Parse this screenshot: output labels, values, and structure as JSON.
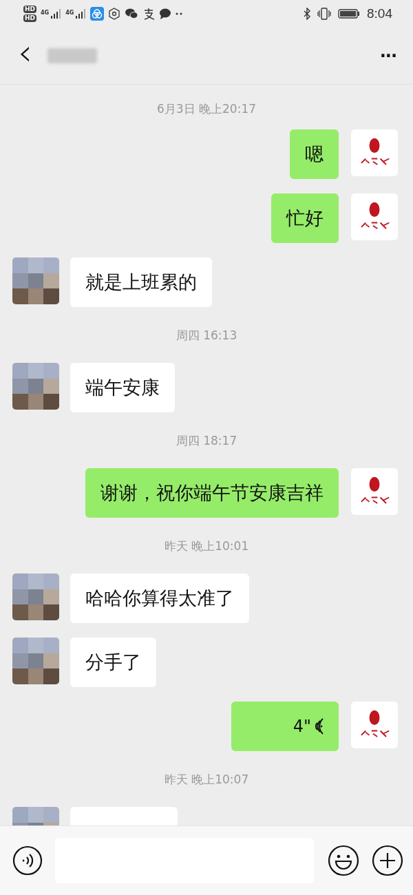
{
  "status_bar": {
    "sim_labels": [
      "HD",
      "HD"
    ],
    "networks": [
      "4G",
      "4G"
    ],
    "time": "8:04"
  },
  "header": {
    "back": "‹",
    "more": "···"
  },
  "messages": [
    {
      "kind": "time",
      "text": "6月3日 晚上20:17"
    },
    {
      "kind": "sent",
      "text": "嗯"
    },
    {
      "kind": "sent",
      "text": "忙好"
    },
    {
      "kind": "received",
      "text": "就是上班累的"
    },
    {
      "kind": "time",
      "text": "周四 16:13"
    },
    {
      "kind": "received",
      "text": "端午安康"
    },
    {
      "kind": "time",
      "text": "周四 18:17"
    },
    {
      "kind": "sent",
      "text": "谢谢，祝你端午节安康吉祥"
    },
    {
      "kind": "time",
      "text": "昨天 晚上10:01"
    },
    {
      "kind": "received",
      "text": "哈哈你算得太准了"
    },
    {
      "kind": "received",
      "text": "分手了"
    },
    {
      "kind": "voice",
      "text": "4\""
    },
    {
      "kind": "time",
      "text": "昨天 晚上10:07"
    },
    {
      "kind": "clipped"
    }
  ]
}
